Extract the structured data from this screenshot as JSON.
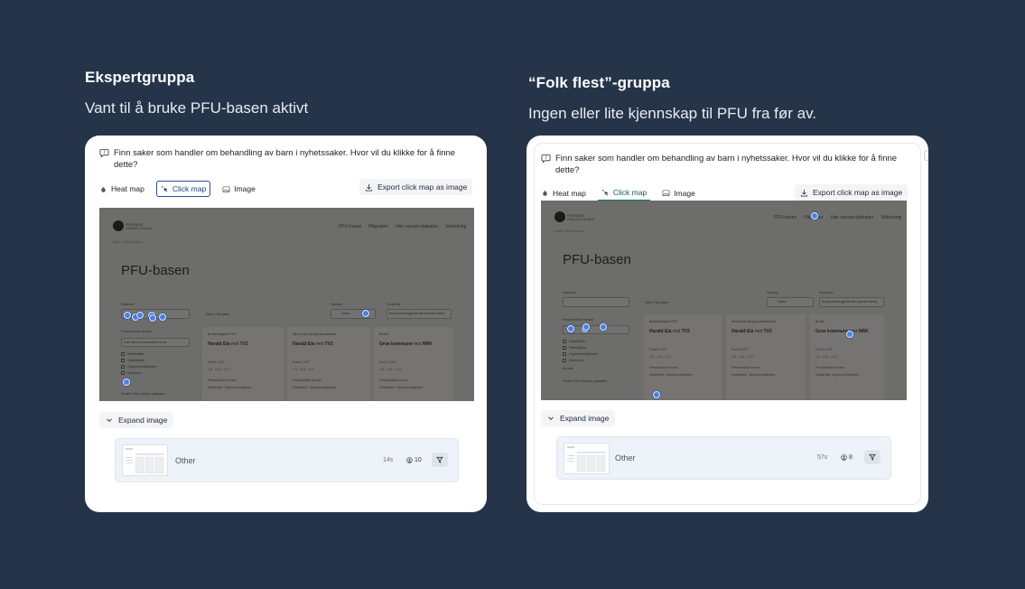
{
  "groups": [
    {
      "title": "Ekspertgruppa",
      "subtitle": "Vant til å bruke PFU-basen aktivt",
      "question": "Finn saker som handler om behandling av barn i nyhetssaker. Hvor vil du klikke for å finne dette?",
      "tabs": [
        {
          "label": "Heat map",
          "icon": "flame-icon"
        },
        {
          "label": "Click map",
          "icon": "pointer-click-icon",
          "active": true
        },
        {
          "label": "Image",
          "icon": "image-icon"
        }
      ],
      "export_label": "Export click map as image",
      "expand_label": "Expand image",
      "summary": {
        "label": "Other",
        "time": "14s",
        "users": "10"
      }
    },
    {
      "title": "“Folk flest”-gruppa",
      "subtitle": "Ingen eller lite kjennskap til PFU fra før av.",
      "question": "Finn saker som handler om behandling av barn i nyhetssaker. Hvor vil du klikke for å finne dette?",
      "tabs": [
        {
          "label": "Heat map",
          "icon": "flame-icon"
        },
        {
          "label": "Click map",
          "icon": "pointer-click-icon",
          "active": true
        },
        {
          "label": "Image",
          "icon": "image-icon"
        }
      ],
      "export_label": "Export click map as image",
      "expand_label": "Expand image",
      "summary": {
        "label": "Other",
        "time": "57s",
        "users": "8"
      }
    }
  ],
  "screenshot": {
    "brand": "PRESSENS FAGLIGE UTVALG",
    "nav": [
      "PFU-basen",
      "Pågsaker",
      "Vær varsom-plakaten",
      "Veiledning"
    ],
    "breadcrumb": "Hjem / PFU-basen",
    "heading": "PFU-basen",
    "search_label": "Søkeord",
    "results_text": "Viser 796 saker",
    "result_type_label": "Visning",
    "sort_label": "Sortering",
    "sort_value": "Beginnende/gjeldende (nyeste først)",
    "view_value": "Saker",
    "filter_label": "Presseetiske temaer",
    "filter_search_placeholder": "Søk etter presseetiske tema",
    "filter_options": [
      "Kildekritikk",
      "Offentlighet",
      "Opphavsrettigheter",
      "Kildevern"
    ],
    "more_filters": "Vis alle",
    "rules_label": "Punkt i Vær varsom-plakaten",
    "cards": [
      {
        "tag": "Brudd tidligere PFU",
        "title_a": "Harald Eia",
        "title_mid": "mot",
        "title_b": "TV2",
        "meta": "Punkt i VVP",
        "codes": [
          "4.3",
          "4.14",
          "4.17"
        ],
        "topics_label": "Presseetiske temaer",
        "topics": [
          "Kildekritikk",
          "Opphavsrettigheter"
        ]
      },
      {
        "tag": "Ikke brudd på god presseskikk",
        "title_a": "Harald Eia",
        "title_mid": "mot",
        "title_b": "TV2",
        "meta": "Punkt i VVP",
        "codes": [
          "4.3",
          "4.14",
          "4.17"
        ],
        "topics_label": "Presseetiske temaer",
        "topics": [
          "Kildekritikk",
          "Opphavsrettigheter"
        ]
      },
      {
        "tag": "Brudd",
        "title_a": "Grue kommune",
        "title_mid": "mot",
        "title_b": "NRK",
        "meta": "Punkt i VVP",
        "codes": [
          "4.3",
          "4.14",
          "4.17"
        ],
        "topics_label": "Presseetiske temaer",
        "topics": [
          "Kildekritikk",
          "Opphavsrettigheter"
        ]
      }
    ]
  }
}
